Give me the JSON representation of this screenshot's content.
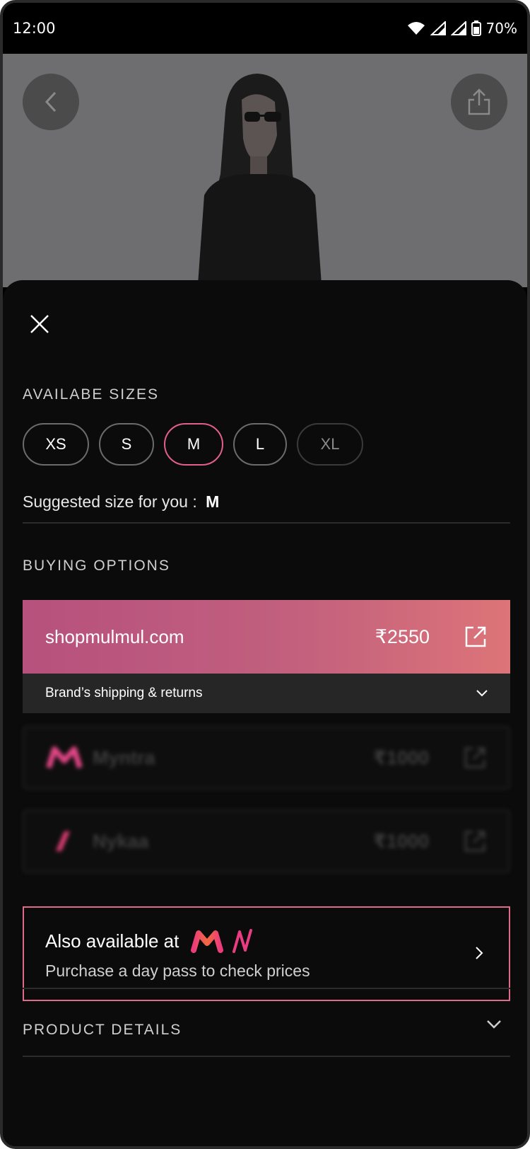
{
  "status_bar": {
    "time": "12:00",
    "battery": "70%",
    "icons": [
      "wifi-icon",
      "signal-icon",
      "signal-icon",
      "battery-icon"
    ]
  },
  "hero": {
    "back_icon": "chevron-left-icon",
    "share_icon": "share-icon"
  },
  "sheet": {
    "close_icon": "close-icon",
    "sizes_title": "AVAILABE SIZES",
    "sizes": [
      {
        "label": "XS",
        "state": "available"
      },
      {
        "label": "S",
        "state": "available"
      },
      {
        "label": "M",
        "state": "selected"
      },
      {
        "label": "L",
        "state": "available"
      },
      {
        "label": "XL",
        "state": "unavailable"
      }
    ],
    "suggested_label": "Suggested size for you :",
    "suggested_value": "M",
    "buying_title": "BUYING OPTIONS",
    "primary_store": {
      "name": "shopmulmul.com",
      "price": "₹2550",
      "shipping": "Brand’s shipping & returns"
    },
    "locked_stores": [
      {
        "name": "Myntra",
        "price": "₹1000"
      },
      {
        "name": "Nykaa",
        "price": "₹1000"
      }
    ],
    "also_available": {
      "title": "Also available at",
      "subtitle": "Purchase a day pass to check prices"
    },
    "details_title": "PRODUCT DETAILS"
  },
  "colors": {
    "accent_pink": "#e2608a",
    "card_gradient_start": "#b6517d",
    "card_gradient_end": "#dc7478",
    "sheet_bg": "#0b0b0b"
  }
}
